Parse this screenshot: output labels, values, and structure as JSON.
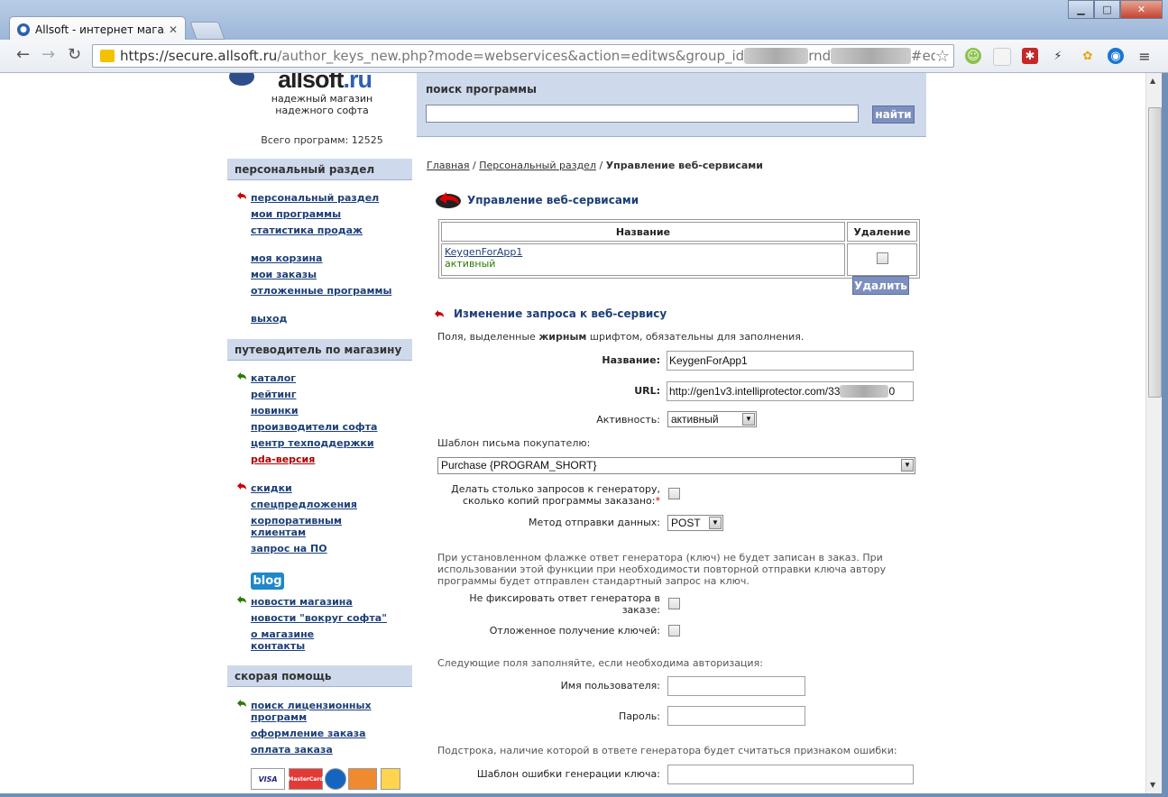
{
  "browser": {
    "tab_title": "Allsoft - интернет магазин",
    "url_host": "https://secure.allsoft.ru",
    "url_path": "/author_keys_new.php?mode=webservices&action=editws&group_id",
    "url_mid": "rnd",
    "url_hash": "#editws"
  },
  "logo": {
    "brand_main": "allsoft",
    "brand_tld": ".ru",
    "tagline_1": "надежный магазин",
    "tagline_2": "надежного софта"
  },
  "totals": "Всего программ: 12525",
  "search": {
    "label": "поиск программы",
    "value": "",
    "button": "найти"
  },
  "sidebar": {
    "personal_head": "персональный раздел",
    "personal": [
      "персональный раздел",
      "мои программы",
      "статистика продаж",
      "моя корзина",
      "мои заказы",
      "отложенные программы",
      "выход"
    ],
    "guide_head": "путеводитель по магазину",
    "guide": [
      "каталог",
      "рейтинг",
      "новинки",
      "производители софта",
      "центр техподдержки",
      "pda-версия",
      "скидки",
      "спецпредложения",
      "корпоративным клиентам",
      "запрос на ПО"
    ],
    "blog": "blog",
    "news": [
      "новости магазина",
      "новости \"вокруг софта\"",
      "о магазине",
      "контакты"
    ],
    "help_head": "скорая помощь",
    "help": [
      "поиск лицензионных программ",
      "оформление заказа",
      "оплата заказа"
    ],
    "payments": [
      "VISA",
      "MasterCard"
    ]
  },
  "breadcrumb": {
    "home": "Главная",
    "sep": "/",
    "personal": "Персональный раздел",
    "current": "Управление веб-сервисами"
  },
  "ws": {
    "title": "Управление веб-сервисами",
    "col_name": "Название",
    "col_delete": "Удаление",
    "rows": [
      {
        "name": "KeygenForApp1",
        "status": "активный"
      }
    ],
    "delete_button": "Удалить"
  },
  "edit": {
    "title": "Изменение запроса к веб-сервису",
    "intro_pre": "Поля, выделенные ",
    "intro_bold": "жирным",
    "intro_post": " шрифтом, обязательны для заполнения.",
    "name_label": "Название:",
    "name_value": "KeygenForApp1",
    "url_label": "URL:",
    "url_value": "http://gen1v3.intelliprotector.com/33",
    "url_tail": "0",
    "active_label": "Активность:",
    "active_value": "активный",
    "template_label": "Шаблон письма покупателю:",
    "template_value": "Purchase {PROGRAM_SHORT}",
    "copies_label_1": "Делать столько запросов к генератору,",
    "copies_label_2": "сколько копий программы заказано:",
    "required_mark": "*",
    "method_label": "Метод отправки данных:",
    "method_value": "POST",
    "flag_note": "При установленном флажке ответ генератора (ключ) не будет записан в заказ. При использовании этой функции при необходимости повторной отправки ключа автору программы будет отправлен стандартный запрос на ключ.",
    "nofix_label_1": "Не фиксировать ответ генератора в",
    "nofix_label_2": "заказе:",
    "deferred_label": "Отложенное получение ключей:",
    "auth_note": "Следующие поля заполняйте, если необходима авторизация:",
    "user_label": "Имя пользователя:",
    "pass_label": "Пароль:",
    "err_note": "Подстрока, наличие которой в ответе генератора будет считаться признаком ошибки:",
    "err_label": "Шаблон ошибки генерации ключа:"
  },
  "colors": {
    "accent": "#1d3f78",
    "panel": "#cfd9ec",
    "button": "#7d8fbf",
    "status_green": "#2c7a00",
    "alert_red": "#b00000"
  }
}
